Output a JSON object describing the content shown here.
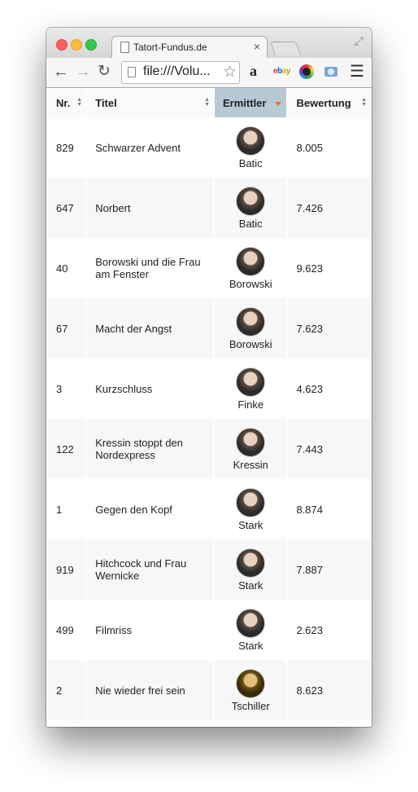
{
  "browser": {
    "tab_title": "Tatort-Fundus.de",
    "tab_close": "×",
    "url": "file:///Volu...",
    "extensions": {
      "amazon": "a",
      "ebay": [
        "e",
        "b",
        "a",
        "y"
      ]
    }
  },
  "table": {
    "headers": {
      "nr": "Nr.",
      "titel": "Titel",
      "ermittler": "Ermittler",
      "bewertung": "Bewertung"
    },
    "sorted_by": "Ermittler",
    "rows": [
      {
        "nr": "829",
        "titel": "Schwarzer Advent",
        "ermittler": "Batic",
        "bewertung": "8.005"
      },
      {
        "nr": "647",
        "titel": "Norbert",
        "ermittler": "Batic",
        "bewertung": "7.426"
      },
      {
        "nr": "40",
        "titel": "Borowski und die Frau am Fenster",
        "ermittler": "Borowski",
        "bewertung": "9.623"
      },
      {
        "nr": "67",
        "titel": "Macht der Angst",
        "ermittler": "Borowski",
        "bewertung": "7.623"
      },
      {
        "nr": "3",
        "titel": "Kurzschluss",
        "ermittler": "Finke",
        "bewertung": "4.623"
      },
      {
        "nr": "122",
        "titel": "Kressin stoppt den Nordexpress",
        "ermittler": "Kressin",
        "bewertung": "7.443"
      },
      {
        "nr": "1",
        "titel": "Gegen den Kopf",
        "ermittler": "Stark",
        "bewertung": "8.874"
      },
      {
        "nr": "919",
        "titel": "Hitchcock und Frau Wernicke",
        "ermittler": "Stark",
        "bewertung": "7.887"
      },
      {
        "nr": "499",
        "titel": "Filmriss",
        "ermittler": "Stark",
        "bewertung": "2.623"
      },
      {
        "nr": "2",
        "titel": "Nie wieder frei sein",
        "ermittler": "Tschiller",
        "bewertung": "8.623"
      }
    ]
  },
  "colors": {
    "sort_accent": "#e8732a",
    "active_header": "#b7c9d4"
  }
}
